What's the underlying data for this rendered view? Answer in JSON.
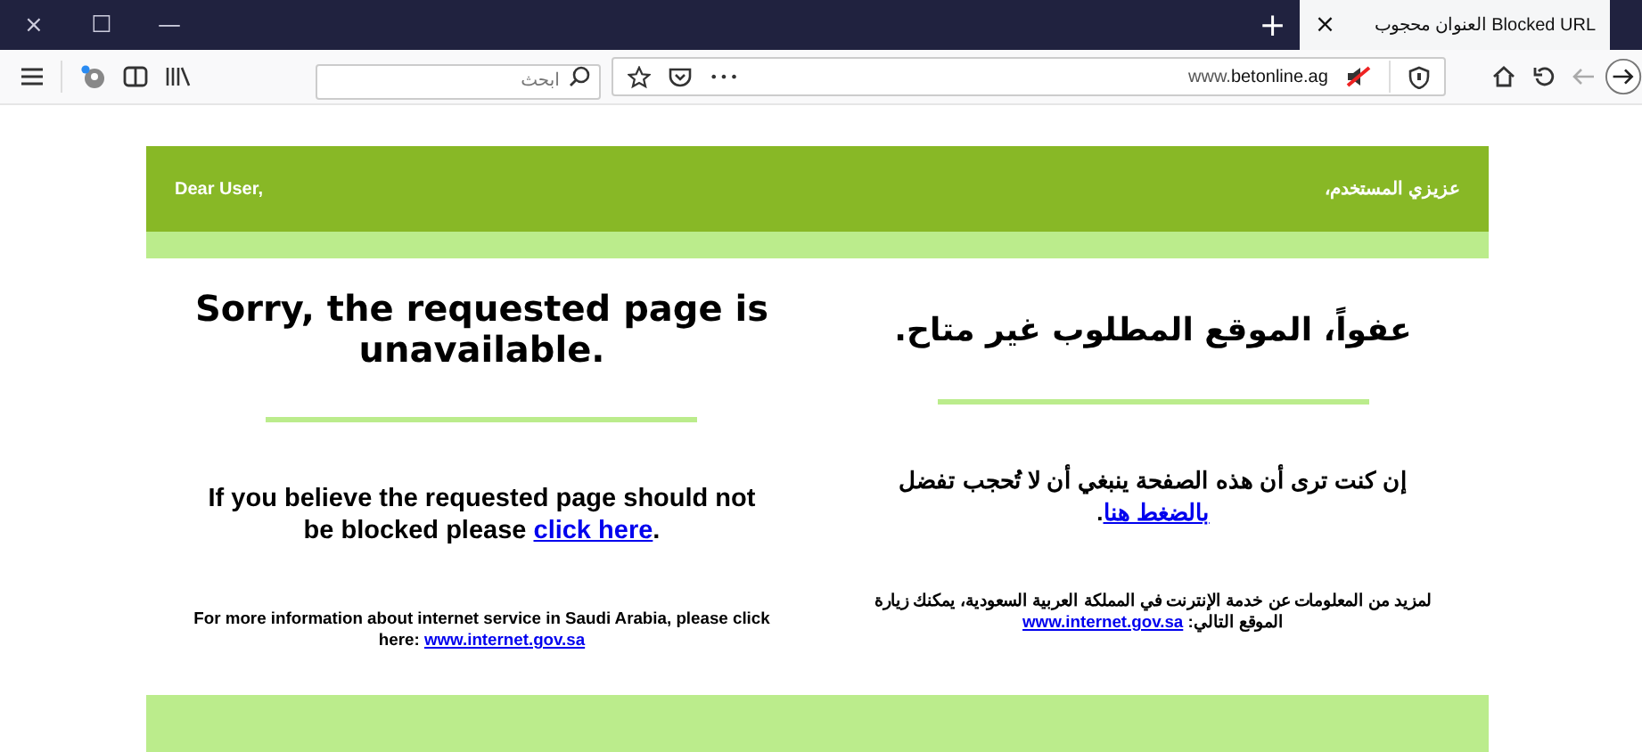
{
  "window": {
    "close": "×",
    "maximize": "☐",
    "minimize": "—"
  },
  "tab": {
    "title": "Blocked URL العنوان محجوب",
    "close": "×",
    "selected": true
  },
  "new_tab": "+",
  "toolbar": {
    "search": {
      "placeholder": "ابحث"
    },
    "more": "•••",
    "url": {
      "prefix": "www.",
      "domain": "betonline.ag"
    }
  },
  "page": {
    "greeting_en": "Dear User,",
    "greeting_ar": "عزيزي المستخدم،",
    "title_en": "Sorry, the requested page is unavailable.",
    "title_ar": "عفواً، الموقع المطلوب غير متاح.",
    "body_en": {
      "text": "If you believe the requested page should not be blocked please ",
      "link": "click here",
      "after": "."
    },
    "body_ar": {
      "text": "إن كنت ترى أن هذه الصفحة ينبغي أن لا تُحجب تفضل ",
      "link": "بالضغط هنا",
      "after": "."
    },
    "info_en": {
      "text": "For more information about internet service in Saudi Arabia, please click here: ",
      "link": "www.internet.gov.sa"
    },
    "info_ar": {
      "text": "لمزيد من المعلومات عن خدمة الإنترنت في المملكة العربية السعودية، يمكنك زيارة الموقع التالي: ",
      "link": "www.internet.gov.sa"
    }
  }
}
